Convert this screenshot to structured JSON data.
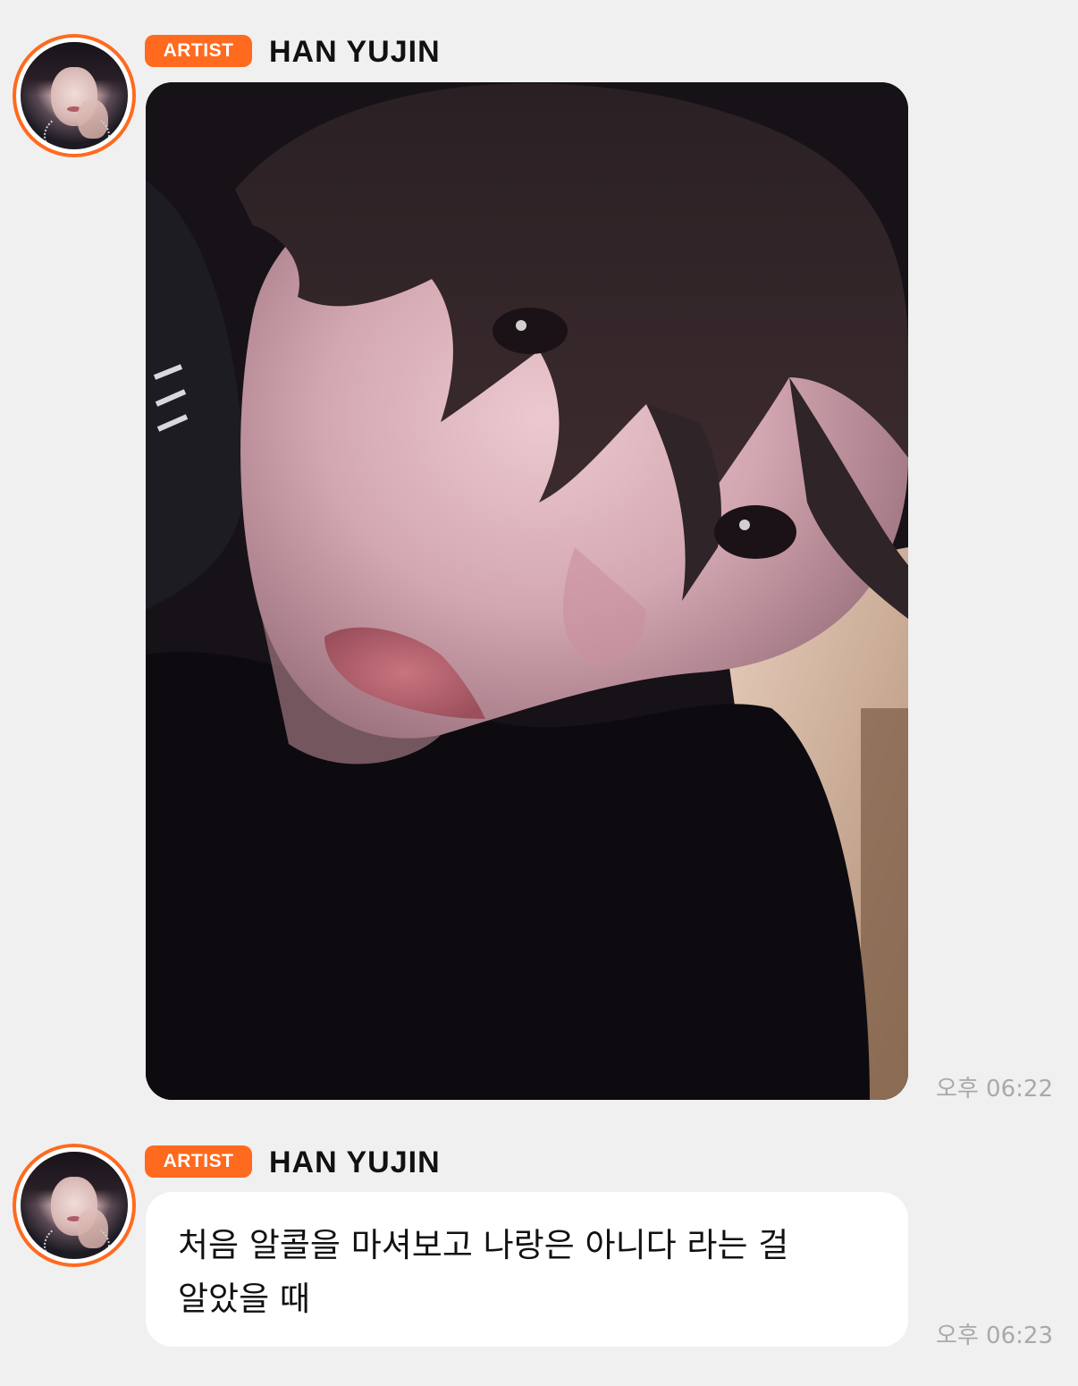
{
  "messages": [
    {
      "sender_badge": "ARTIST",
      "sender_name": "HAN YUJIN",
      "type": "photo",
      "time": "오후 06:22"
    },
    {
      "sender_badge": "ARTIST",
      "sender_name": "HAN YUJIN",
      "type": "text",
      "text": "처음 알콜을 마셔보고 나랑은 아니다 라는 걸 알았을 때",
      "time": "오후 06:23"
    }
  ],
  "colors": {
    "background": "#f0f0f0",
    "badge": "#ff6a1f",
    "bubble": "#ffffff",
    "time_text": "#a9a9a9"
  },
  "icons": {
    "avatar": "artist-profile-avatar"
  }
}
